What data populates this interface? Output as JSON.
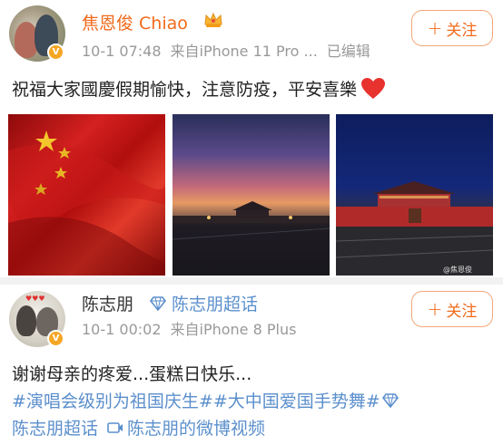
{
  "posts": [
    {
      "author": "焦恩俊 Chiao",
      "verified_badge": "V",
      "time": "10-1 07:48",
      "source": "来自iPhone 11 Pro ...",
      "edited": "已编辑",
      "follow_label": "关注",
      "follow_plus": "+",
      "text": "祝福大家國慶假期愉快，注意防疫，平安喜樂",
      "images": [
        "flag-image",
        "sunset-tiananmen-image",
        "tiananmen-night-image"
      ],
      "image_watermark": "@焦恩俊"
    },
    {
      "author": "陈志朋",
      "verified_badge": "V",
      "supertopic": "陈志朋超话",
      "time": "10-1 00:02",
      "source": "来自iPhone 8 Plus",
      "follow_label": "关注",
      "follow_plus": "+",
      "text_line1": "谢谢母亲的疼爱...蛋糕日快乐...",
      "hashtags": "#演唱会级别为祖国庆生##大中国爱国手势舞#",
      "line3_topic": "陈志朋超话",
      "video_link": "陈志朋的微博视频"
    }
  ],
  "colors": {
    "orange_accent": "#f06a1c",
    "link_blue": "#5b8fcc",
    "meta_gray": "#999999"
  }
}
